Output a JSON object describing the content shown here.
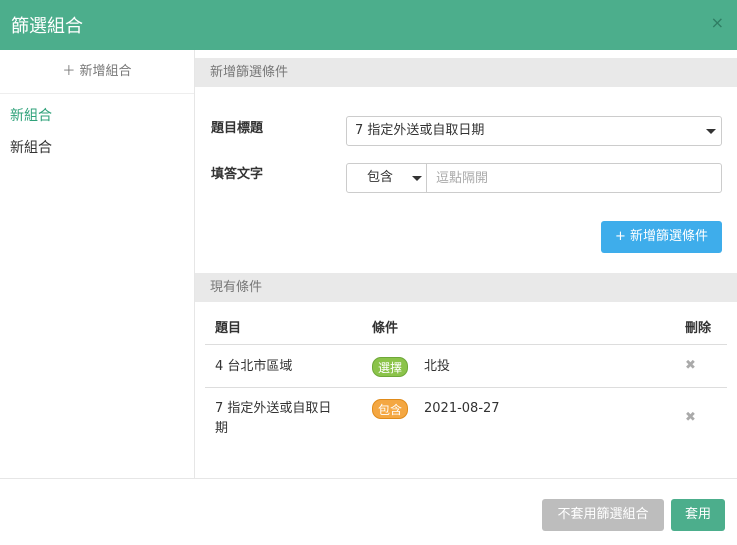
{
  "header": {
    "title": "篩選組合",
    "close_label": "×"
  },
  "sidebar": {
    "add_label": "＋ 新增組合",
    "items": [
      {
        "label": "新組合",
        "active": true
      },
      {
        "label": "新組合",
        "active": false
      }
    ]
  },
  "form": {
    "section_title": "新增篩選條件",
    "question_label": "題目標題",
    "question_value": "7 指定外送或自取日期",
    "answer_label": "填答文字",
    "operator_value": "包含",
    "answer_placeholder": "逗點隔開",
    "add_condition_label": "+ 新增篩選條件"
  },
  "conditions": {
    "section_title": "現有條件",
    "columns": [
      "題目",
      "條件",
      "刪除"
    ],
    "rows": [
      {
        "question": "4 台北市區域",
        "badge": "選擇",
        "badge_color": "#8bc34a",
        "value": "北投"
      },
      {
        "question_line1": "7 指定外送或自取日",
        "question_line2": "期",
        "badge": "包含",
        "badge_color": "#f4a742",
        "value": "2021-08-27"
      }
    ]
  },
  "footer": {
    "cancel_label": "不套用篩選組合",
    "apply_label": "套用"
  },
  "colors": {
    "brand": "#4cae8c",
    "primary_button": "#3eadeb",
    "disabled_button": "#bdbdbd"
  }
}
